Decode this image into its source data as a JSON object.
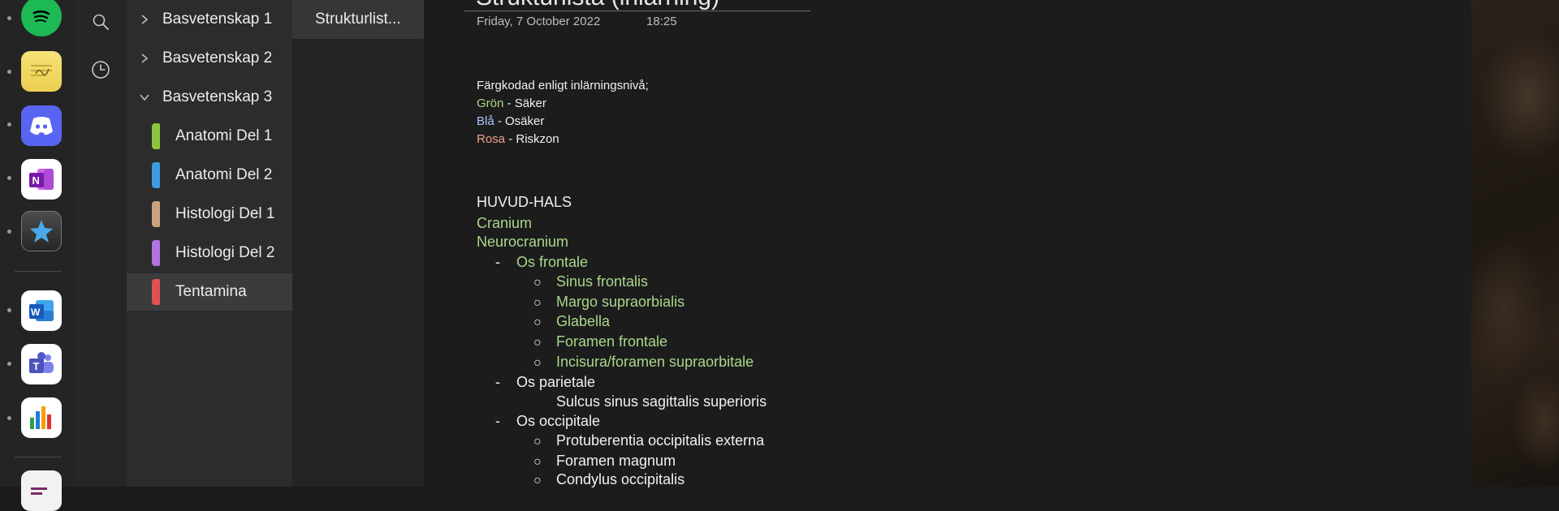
{
  "notebooks": [
    {
      "label": "Basvetenskap 1",
      "expanded": false
    },
    {
      "label": "Basvetenskap 2",
      "expanded": false
    },
    {
      "label": "Basvetenskap 3",
      "expanded": true
    }
  ],
  "sections": [
    {
      "label": "Anatomi Del 1",
      "color": "#8cc63f"
    },
    {
      "label": "Anatomi Del 2",
      "color": "#3d9ae0"
    },
    {
      "label": "Histologi Del 1",
      "color": "#c9a27e"
    },
    {
      "label": "Histologi Del 2",
      "color": "#b173e0"
    },
    {
      "label": "Tentamina",
      "color": "#e05252"
    }
  ],
  "pages": [
    {
      "label": "Strukturlist..."
    }
  ],
  "note": {
    "title": "Strukturlista (inlärning)",
    "date": "Friday, 7 October 2022",
    "time": "18:25",
    "legend_intro": "Färgkodad enligt inlärningsnivå;",
    "legend": [
      {
        "term": "Grön",
        "desc": " - Säker"
      },
      {
        "term": "Blå",
        "desc": " - Osäker"
      },
      {
        "term": "Rosa",
        "desc": " - Riskzon"
      }
    ],
    "heading": "HUVUD-HALS",
    "cranium": "Cranium",
    "neurocranium": "Neurocranium",
    "dash": "-",
    "circle": "○",
    "os_frontale": "Os frontale",
    "frontale_items": [
      "Sinus frontalis",
      "Margo supraorbialis",
      "Glabella",
      "Foramen frontale",
      "Incisura/foramen supraorbitale"
    ],
    "os_parietale": "Os parietale",
    "parietale_items": [
      "Sulcus sinus sagittalis superioris"
    ],
    "os_occipitale": "Os occipitale",
    "occipitale_items": [
      "Protuberentia occipitalis externa",
      "Foramen magnum",
      "Condylus occipitalis"
    ]
  },
  "dock": {
    "apps": [
      "spotify-icon",
      "stickies-icon",
      "discord-icon",
      "onenote-icon",
      "starlight-icon",
      "word-icon",
      "teams-icon",
      "numbers-icon",
      "preview-icon"
    ]
  }
}
